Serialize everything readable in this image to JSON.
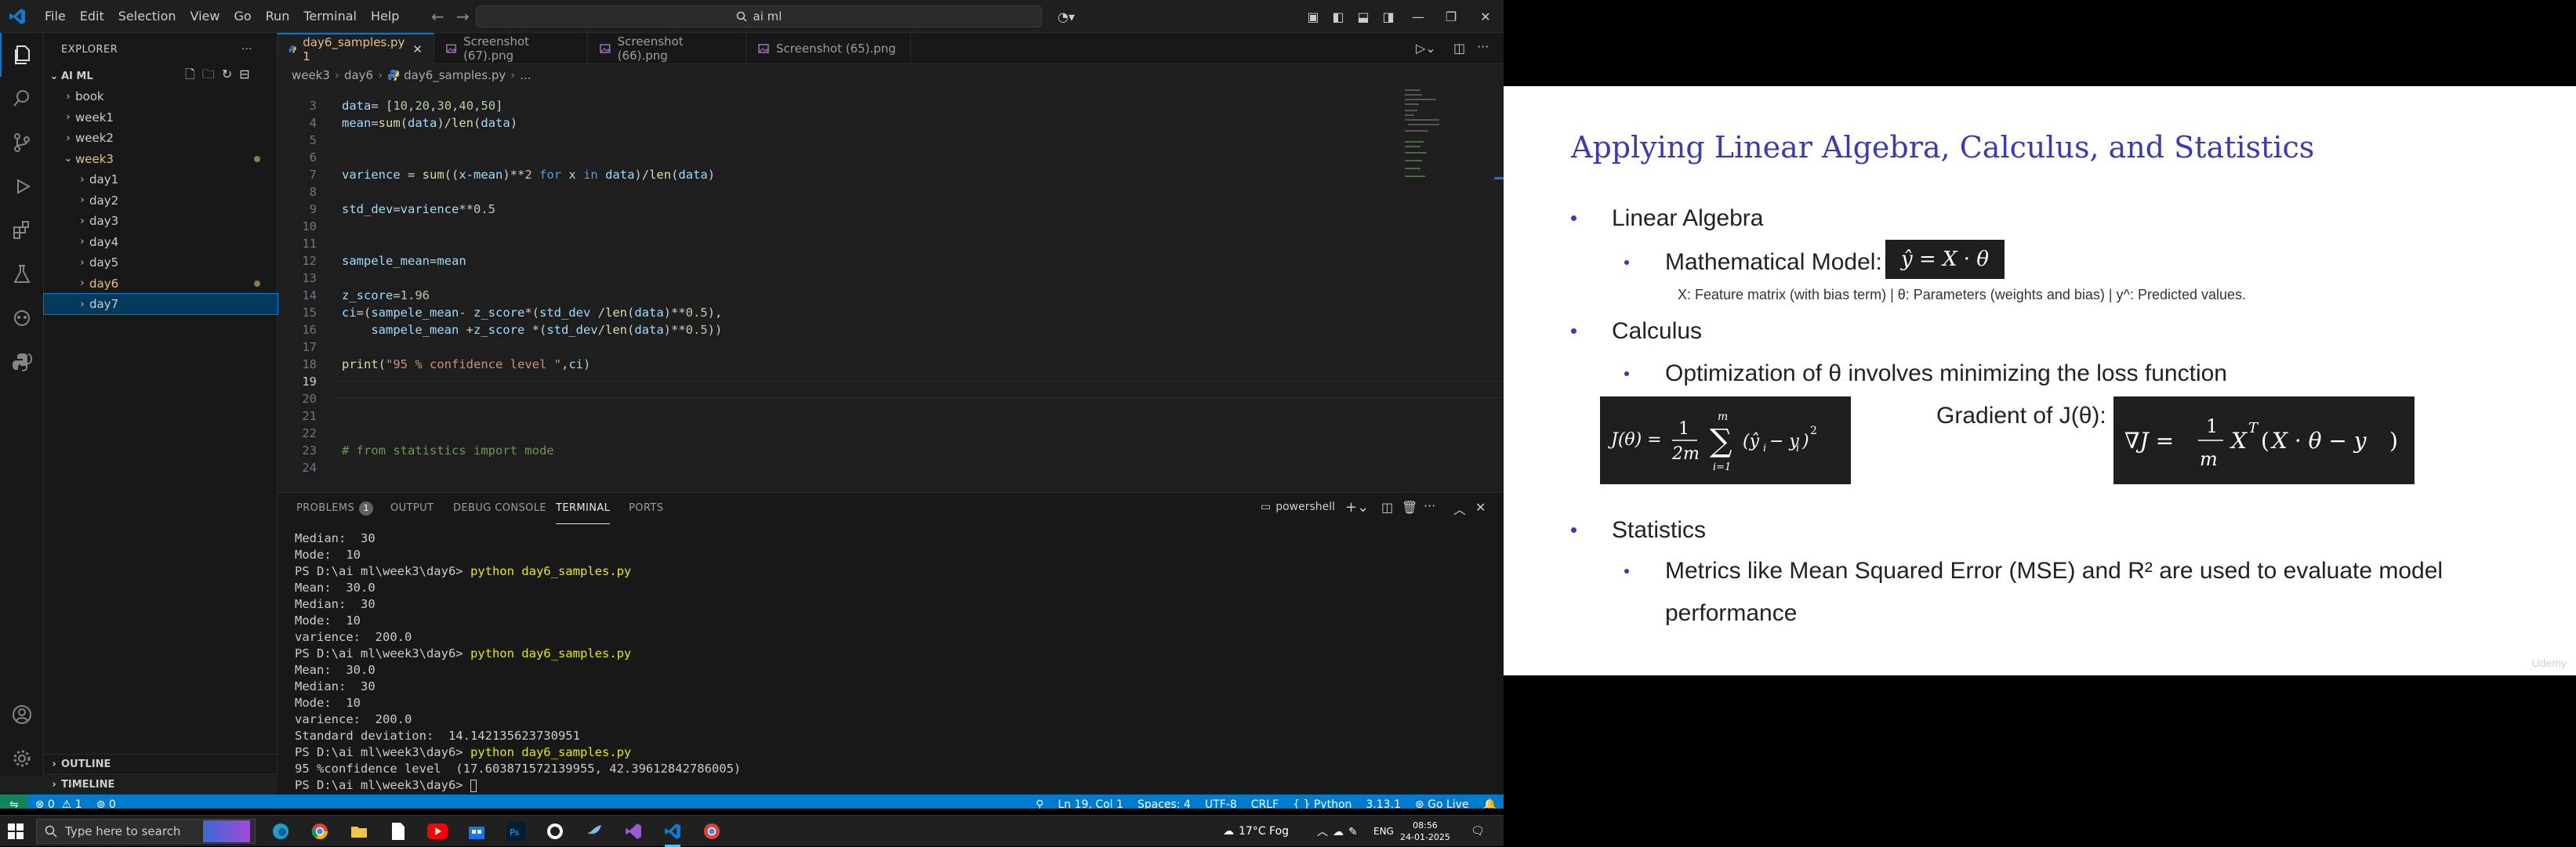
{
  "vscode": {
    "menu": [
      "File",
      "Edit",
      "Selection",
      "View",
      "Go",
      "Run",
      "Terminal",
      "Help"
    ],
    "command_center": "ai ml",
    "explorer_title": "EXPLORER",
    "workspace": "AI ML",
    "tree": [
      {
        "label": "book",
        "indent": 1,
        "expanded": false,
        "modified": false
      },
      {
        "label": "week1",
        "indent": 1,
        "expanded": false,
        "modified": false
      },
      {
        "label": "week2",
        "indent": 1,
        "expanded": false,
        "modified": false
      },
      {
        "label": "week3",
        "indent": 1,
        "expanded": true,
        "modified": true
      },
      {
        "label": "day1",
        "indent": 2,
        "expanded": false,
        "modified": false
      },
      {
        "label": "day2",
        "indent": 2,
        "expanded": false,
        "modified": false
      },
      {
        "label": "day3",
        "indent": 2,
        "expanded": false,
        "modified": false
      },
      {
        "label": "day4",
        "indent": 2,
        "expanded": false,
        "modified": false
      },
      {
        "label": "day5",
        "indent": 2,
        "expanded": false,
        "modified": false
      },
      {
        "label": "day6",
        "indent": 2,
        "expanded": false,
        "modified": true
      },
      {
        "label": "day7",
        "indent": 2,
        "expanded": false,
        "modified": false,
        "selected": true
      }
    ],
    "outline_label": "OUTLINE",
    "timeline_label": "TIMELINE",
    "tabs": [
      {
        "label": "day6_samples.py 1",
        "active": true
      },
      {
        "label": "Screenshot (67).png",
        "active": false
      },
      {
        "label": "Screenshot (66).png",
        "active": false
      },
      {
        "label": "Screenshot (65).png",
        "active": false
      }
    ],
    "breadcrumb": [
      "week3",
      "day6",
      "day6_samples.py",
      "..."
    ],
    "line_numbers": [
      "3",
      "4",
      "5",
      "6",
      "7",
      "8",
      "9",
      "10",
      "11",
      "12",
      "13",
      "14",
      "15",
      "16",
      "17",
      "18",
      "19",
      "20",
      "21",
      "22",
      "23",
      "24"
    ],
    "code_lines": {
      "l3": "data= [10,20,30,40,50]",
      "l4": "mean=sum(data)/len(data)",
      "l7": "varience = sum((x-mean)**2 for x in data)/len(data)",
      "l9": "std_dev=varience**0.5",
      "l12": "sampele_mean=mean",
      "l14": "z_score=1.96",
      "l15": "ci=(sampele_mean- z_score*(std_dev /len(data)**0.5),",
      "l16": "    sampele_mean +z_score *(std_dev/len(data)**0.5))",
      "l18": "print(\"95 % confidence level \",ci)",
      "l23": "# from statistics import mode"
    },
    "panel_tabs": [
      "PROBLEMS",
      "OUTPUT",
      "DEBUG CONSOLE",
      "TERMINAL",
      "PORTS"
    ],
    "problems_count": "1",
    "terminal_shell": "powershell",
    "terminal_lines": [
      {
        "text": "Median:  30",
        "cmd": ""
      },
      {
        "text": "Mode:  10",
        "cmd": ""
      },
      {
        "text": "PS D:\\ai ml\\week3\\day6> ",
        "cmd": "python day6_samples.py"
      },
      {
        "text": "Mean:  30.0",
        "cmd": ""
      },
      {
        "text": "Median:  30",
        "cmd": ""
      },
      {
        "text": "Mode:  10",
        "cmd": ""
      },
      {
        "text": "varience:  200.0",
        "cmd": ""
      },
      {
        "text": "PS D:\\ai ml\\week3\\day6> ",
        "cmd": "python day6_samples.py"
      },
      {
        "text": "Mean:  30.0",
        "cmd": ""
      },
      {
        "text": "Median:  30",
        "cmd": ""
      },
      {
        "text": "Mode:  10",
        "cmd": ""
      },
      {
        "text": "varience:  200.0",
        "cmd": ""
      },
      {
        "text": "Standard deviation:  14.142135623730951",
        "cmd": ""
      },
      {
        "text": "PS D:\\ai ml\\week3\\day6> ",
        "cmd": "python day6_samples.py"
      },
      {
        "text": "95 %confidence level  (17.603871572139955, 42.39612842786005)",
        "cmd": ""
      },
      {
        "text": "PS D:\\ai ml\\week3\\day6> ",
        "cmd": "",
        "cursor": true
      }
    ],
    "status": {
      "errors": "0",
      "warnings": "1",
      "ports": "0",
      "position": "Ln 19, Col 1",
      "spaces": "Spaces: 4",
      "encoding": "UTF-8",
      "eol": "CRLF",
      "language": "Python",
      "version": "3.13.1",
      "golive": "Go Live"
    }
  },
  "taskbar": {
    "search_placeholder": "Type here to search",
    "weather": "17°C  Fog",
    "lang": "ENG",
    "time": "08:56",
    "date": "24-01-2025"
  },
  "slide": {
    "title": "Applying Linear Algebra, Calculus, and Statistics",
    "section1": "Linear Algebra",
    "model_label": "Mathematical Model:",
    "model_eq": "ŷ = X · θ",
    "model_note": "X: Feature matrix (with bias term) | θ: Parameters (weights and bias) | y^: Predicted values.",
    "section2": "Calculus",
    "opt_text": "Optimization of θ involves minimizing the loss function",
    "gradient_label": "Gradient of J(θ):",
    "section3": "Statistics",
    "stats_text_line1": "Metrics like Mean Squared Error (MSE) and R² are used to evaluate model",
    "stats_text_line2": "performance",
    "watermark": "Udemy"
  }
}
